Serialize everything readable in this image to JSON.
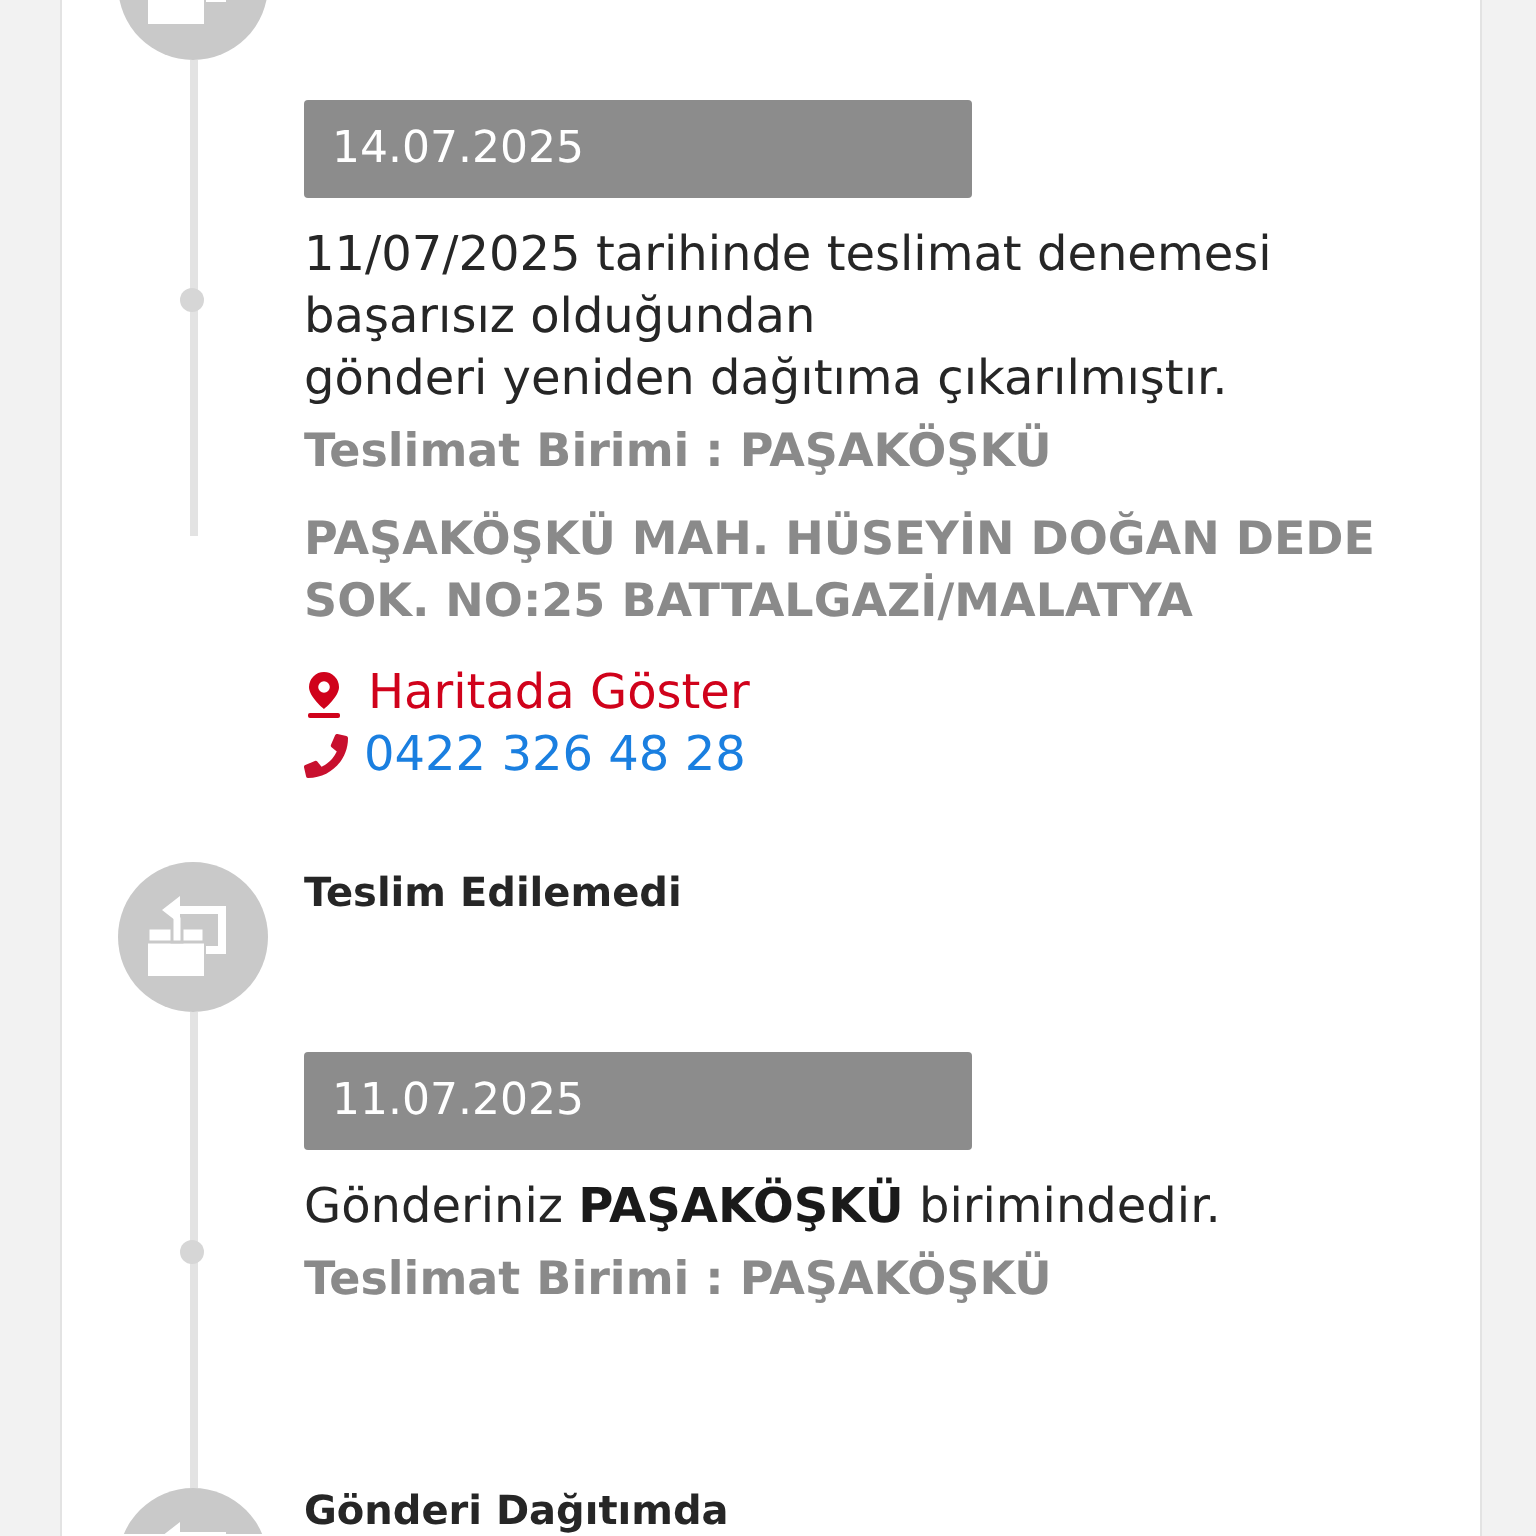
{
  "timeline": [
    {
      "kind": "status"
    },
    {
      "kind": "event",
      "date": "14.07.2025",
      "description_lines": [
        "11/07/2025 tarihinde teslimat denemesi",
        "başarısız olduğundan",
        "gönderi yeniden dağıtıma çıkarılmıştır."
      ],
      "unit": "Teslimat Birimi : PAŞAKÖŞKÜ",
      "address_lines": [
        "PAŞAKÖŞKÜ MAH. HÜSEYİN DOĞAN DEDE",
        "SOK. NO:25 BATTALGAZİ/MALATYA"
      ],
      "map_link": "Haritada Göster",
      "phone": "0422 326 48 28"
    },
    {
      "kind": "status",
      "title": "Teslim Edilemedi"
    },
    {
      "kind": "event",
      "date": "11.07.2025",
      "description_lines": [
        "Gönderiniz **PAŞAKÖŞKÜ** birimindedir."
      ],
      "unit": "Teslimat Birimi : PAŞAKÖŞKÜ"
    },
    {
      "kind": "status",
      "title": "Gönderi Dağıtımda"
    }
  ]
}
